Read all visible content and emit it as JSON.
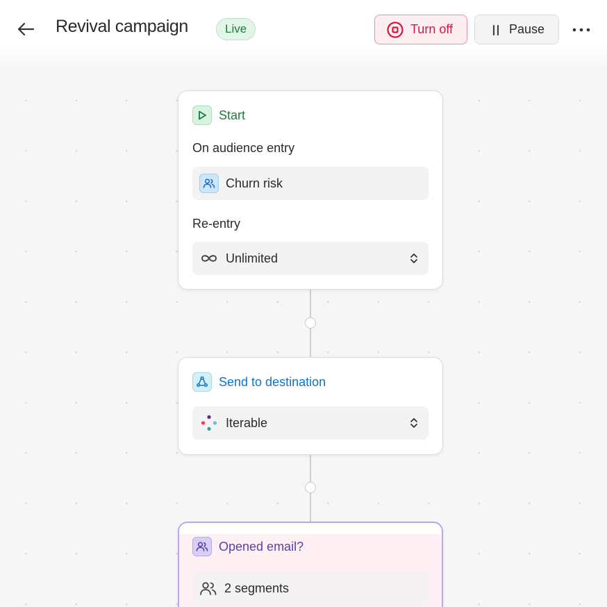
{
  "header": {
    "title": "Revival campaign",
    "status_badge": "Live",
    "turn_off_label": "Turn off",
    "pause_label": "Pause"
  },
  "colors": {
    "live_green": "#1f7a3a",
    "turn_off_red": "#d3173f",
    "start_green": "#1c7a40",
    "destination_blue": "#1273c6",
    "branch_purple": "#5a3fa8"
  },
  "nodes": {
    "start": {
      "title": "Start",
      "icon": "play-icon",
      "trigger_label": "On audience entry",
      "audience": "Churn risk",
      "audience_icon": "users-icon",
      "reentry_label": "Re-entry",
      "reentry_value": "Unlimited",
      "reentry_icon": "infinity-icon"
    },
    "destination": {
      "title": "Send to destination",
      "icon": "recycle-icon",
      "destination_value": "Iterable",
      "destination_icon": "iterable-logo"
    },
    "branch": {
      "title": "Opened email?",
      "icon": "users-icon",
      "segments": "2 segments",
      "segments_icon": "users-icon"
    }
  }
}
